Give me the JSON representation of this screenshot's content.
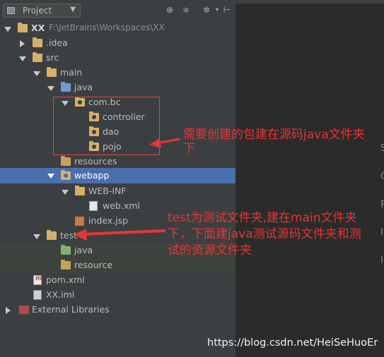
{
  "header": {
    "project_label": "Project",
    "tools": [
      "target-icon",
      "collapse-icon",
      "gear-icon",
      "hide-icon"
    ]
  },
  "tree": {
    "root": {
      "name": "XX",
      "path": "F:\\JetBrains\\Workspaces\\XX"
    },
    "idea": ".idea",
    "src": "src",
    "main": "main",
    "java": "java",
    "com_bc": "com.bc",
    "controller": "controller",
    "dao": "dao",
    "pojo": "pojo",
    "resources": "resources",
    "webapp": "webapp",
    "webinf": "WEB-INF",
    "webxml": "web.xml",
    "indexjsp": "index.jsp",
    "test": "test",
    "test_java": "java",
    "test_resource": "resource",
    "pom": "pom.xml",
    "iml": "XX.iml",
    "libs": "External Libraries"
  },
  "editor_gutter": [
    "S",
    "C",
    "F",
    "I",
    "I"
  ],
  "annotations": {
    "note1_line1": "需要创建的包建在源码java文件夹",
    "note1_line2": "下",
    "note2_line1": "test为测试文件夹,建在main文件夹",
    "note2_line2": "下，下面建java测试源码文件夹和测",
    "note2_line3": "试的资源文件夹"
  },
  "watermark": "https://blog.csdn.net/HeiSeHuoEr",
  "colors": {
    "selection": "#4b6eaf",
    "annotation": "#e63535",
    "panel": "#3c3f41",
    "editor": "#2b2b2b"
  }
}
